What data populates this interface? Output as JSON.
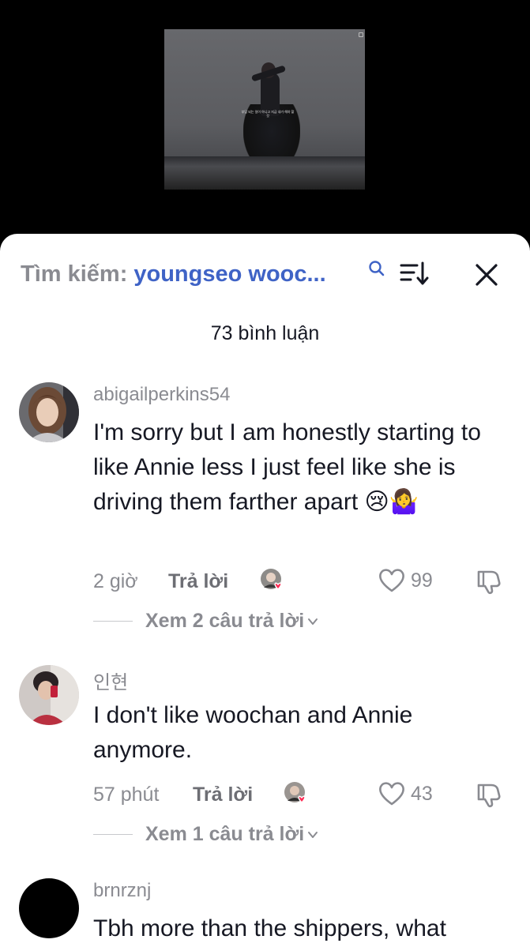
{
  "video": {
    "caption": "부담 되는 일이 아니고 지금 내가 해야 할 것"
  },
  "search": {
    "prefix": "Tìm kiếm:",
    "query": "youngseo wooc..."
  },
  "comment_count": "73 bình luận",
  "comments": [
    {
      "username": "abigailperkins54",
      "text": "I'm sorry but I am honestly starting to like Annie less I just feel like she is driving them farther apart 😢🤷‍♀️",
      "time": "2 giờ",
      "reply_label": "Trả lời",
      "likes": "99",
      "view_replies": "Xem 2 câu trả lời"
    },
    {
      "username": "인현",
      "text": "I don't like woochan and Annie anymore.",
      "time": "57 phút",
      "reply_label": "Trả lời",
      "likes": "43",
      "view_replies": "Xem 1 câu trả lời"
    },
    {
      "username": "brnrznj",
      "text": "Tbh more than the shippers, what"
    }
  ],
  "colors": {
    "search_query": "#3f63c6",
    "heart_badge": "#fe2c55"
  }
}
